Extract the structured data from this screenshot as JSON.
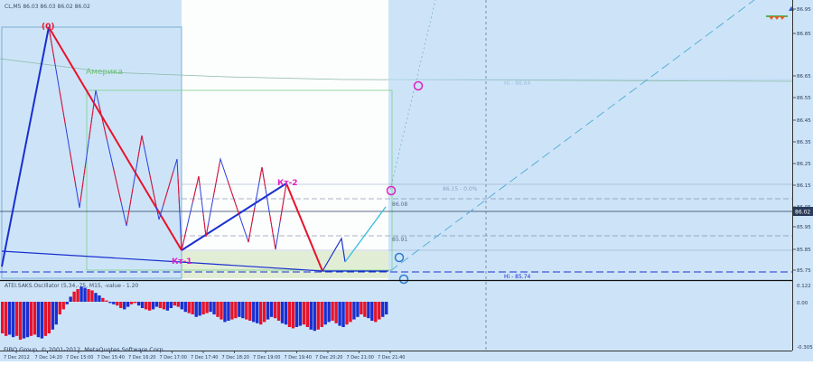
{
  "header": {
    "symbol_line": "CL,M5  86.03 86.03 86.02 86.02"
  },
  "price_axis": {
    "ticks": [
      "86.95",
      "86.85",
      "86.65",
      "86.55",
      "86.45",
      "86.35",
      "86.25",
      "86.15",
      "86.05",
      "85.95",
      "85.85",
      "85.75"
    ],
    "current_price": "86.02"
  },
  "annotations": {
    "zero_label": "(0)",
    "america_label": "Америка",
    "k2_label": "Кт-2",
    "k1_label": "Кт-1",
    "hi_upper": "Hi - 86.64",
    "fib_line": "86.15 - 0.0%",
    "level_8608": "86.08",
    "level_8591": "85.91",
    "hi_lower": "Hi - 85.74"
  },
  "oscillator": {
    "title": "ATEI.SAKS.Oscillator (5,34,-75, M15, -value - 1.20",
    "ticks": [
      "0.122",
      "0.00",
      "-0.305"
    ],
    "bars": [
      -0.25,
      -0.27,
      -0.26,
      -0.28,
      -0.27,
      -0.3,
      -0.29,
      -0.28,
      -0.27,
      -0.26,
      -0.28,
      -0.29,
      -0.27,
      -0.25,
      -0.22,
      -0.18,
      -0.1,
      -0.06,
      -0.02,
      0.04,
      0.08,
      0.1,
      0.12,
      0.11,
      0.1,
      0.09,
      0.07,
      0.05,
      0.03,
      0.01,
      -0.01,
      -0.02,
      -0.03,
      -0.05,
      -0.06,
      -0.04,
      -0.02,
      -0.01,
      -0.03,
      -0.05,
      -0.06,
      -0.07,
      -0.06,
      -0.04,
      -0.05,
      -0.06,
      -0.07,
      -0.05,
      -0.03,
      -0.04,
      -0.06,
      -0.08,
      -0.09,
      -0.1,
      -0.12,
      -0.11,
      -0.1,
      -0.09,
      -0.08,
      -0.1,
      -0.12,
      -0.14,
      -0.16,
      -0.15,
      -0.14,
      -0.13,
      -0.12,
      -0.13,
      -0.14,
      -0.15,
      -0.16,
      -0.17,
      -0.18,
      -0.16,
      -0.14,
      -0.12,
      -0.13,
      -0.15,
      -0.17,
      -0.18,
      -0.2,
      -0.21,
      -0.2,
      -0.19,
      -0.18,
      -0.2,
      -0.22,
      -0.23,
      -0.22,
      -0.2,
      -0.18,
      -0.16,
      -0.15,
      -0.17,
      -0.19,
      -0.2,
      -0.18,
      -0.16,
      -0.14,
      -0.12,
      -0.1,
      -0.12,
      -0.13,
      -0.15,
      -0.16,
      -0.14,
      -0.12,
      -0.1
    ]
  },
  "time_axis": {
    "labels": [
      "7 Dec 2012",
      "7 Dec 14:20",
      "7 Dec 15:00",
      "7 Dec 15:40",
      "7 Dec 16:20",
      "7 Dec 17:00",
      "7 Dec 17:40",
      "7 Dec 18:20",
      "7 Dec 19:00",
      "7 Dec 19:40",
      "7 Dec 20:20",
      "7 Dec 21:00",
      "7 Dec 21:40"
    ]
  },
  "footer": {
    "copyright": "FIBO Group, © 2001-2012, MetaQuotes Software Corp."
  },
  "colors": {
    "background": "#cde4f8",
    "bull_wave": "#1a2fd0",
    "bear_wave": "#e8122a",
    "grid": "#9fb8d8",
    "highlight": "#ffffff",
    "magenta": "#e020c0"
  }
}
